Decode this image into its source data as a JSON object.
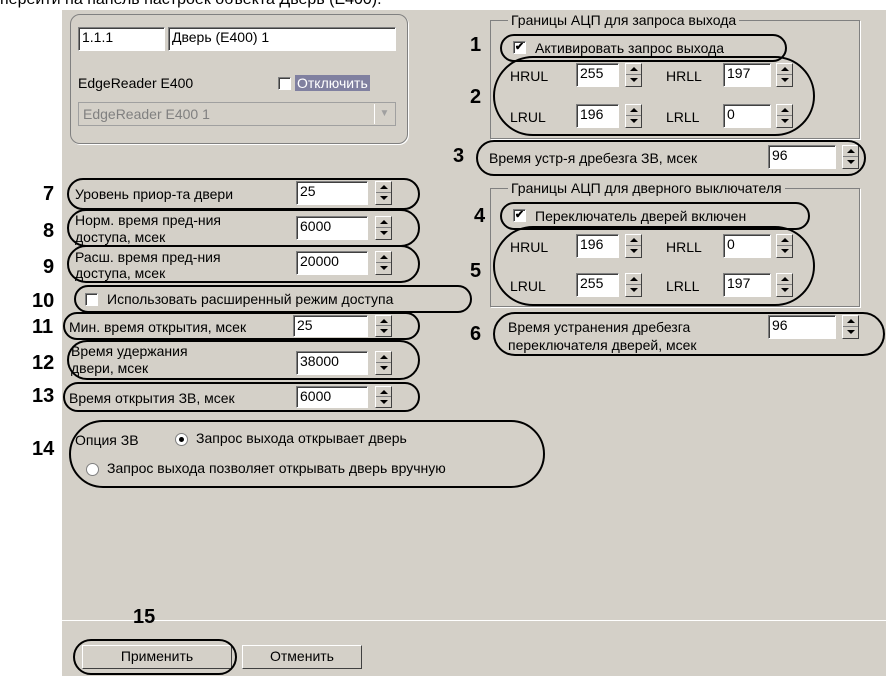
{
  "header_text": "перейти на панель настроек объекта Дверь (E400).",
  "device": {
    "id": "1.1.1",
    "name": "Дверь (E400) 1",
    "reader_label": "EdgeReader E400",
    "disable_label": "Отключить",
    "reader_select": "EdgeReader E400 1"
  },
  "exit_adc": {
    "title": "Границы АЦП для запроса выхода",
    "activate_label": "Активировать запрос выхода",
    "hrul_label": "HRUL",
    "hrul": "255",
    "hrll_label": "HRLL",
    "hrll": "197",
    "lrul_label": "LRUL",
    "lrul": "196",
    "lrll_label": "LRLL",
    "lrll": "0"
  },
  "exit_debounce": {
    "label": "Время устр-я дребезга ЗВ, мсек",
    "value": "96"
  },
  "door_adc": {
    "title": "Границы АЦП для дверного выключателя",
    "switch_label": "Переключатель дверей включен",
    "hrul_label": "HRUL",
    "hrul": "196",
    "hrll_label": "HRLL",
    "hrll": "0",
    "lrul_label": "LRUL",
    "lrul": "255",
    "lrll_label": "LRLL",
    "lrll": "197"
  },
  "door_debounce": {
    "label_line1": "Время устранения дребезга",
    "label_line2": "переключателя дверей, мсек",
    "value": "96"
  },
  "left": {
    "priority_label": "Уровень приор-та двери",
    "priority": "25",
    "norm_label1": "Норм. время пред-ния",
    "norm_label2": "доступа, мсек",
    "norm": "6000",
    "ext_label1": "Расш. время пред-ния",
    "ext_label2": "доступа, мсек",
    "ext": "20000",
    "use_ext_label": "Использовать расширенный режим доступа",
    "min_open_label": "Мин. время открытия, мсек",
    "min_open": "25",
    "hold_label1": "Время удержания",
    "hold_label2": "двери, мсек",
    "hold": "38000",
    "exit_open_label": "Время открытия ЗВ, мсек",
    "exit_open": "6000"
  },
  "exit_option": {
    "label": "Опция ЗВ",
    "opt1": "Запрос выхода открывает дверь",
    "opt2": "Запрос выхода позволяет открывать дверь вручную"
  },
  "buttons": {
    "apply": "Применить",
    "cancel": "Отменить"
  },
  "markers": [
    "1",
    "2",
    "3",
    "4",
    "5",
    "6",
    "7",
    "8",
    "9",
    "10",
    "11",
    "12",
    "13",
    "14",
    "15"
  ]
}
